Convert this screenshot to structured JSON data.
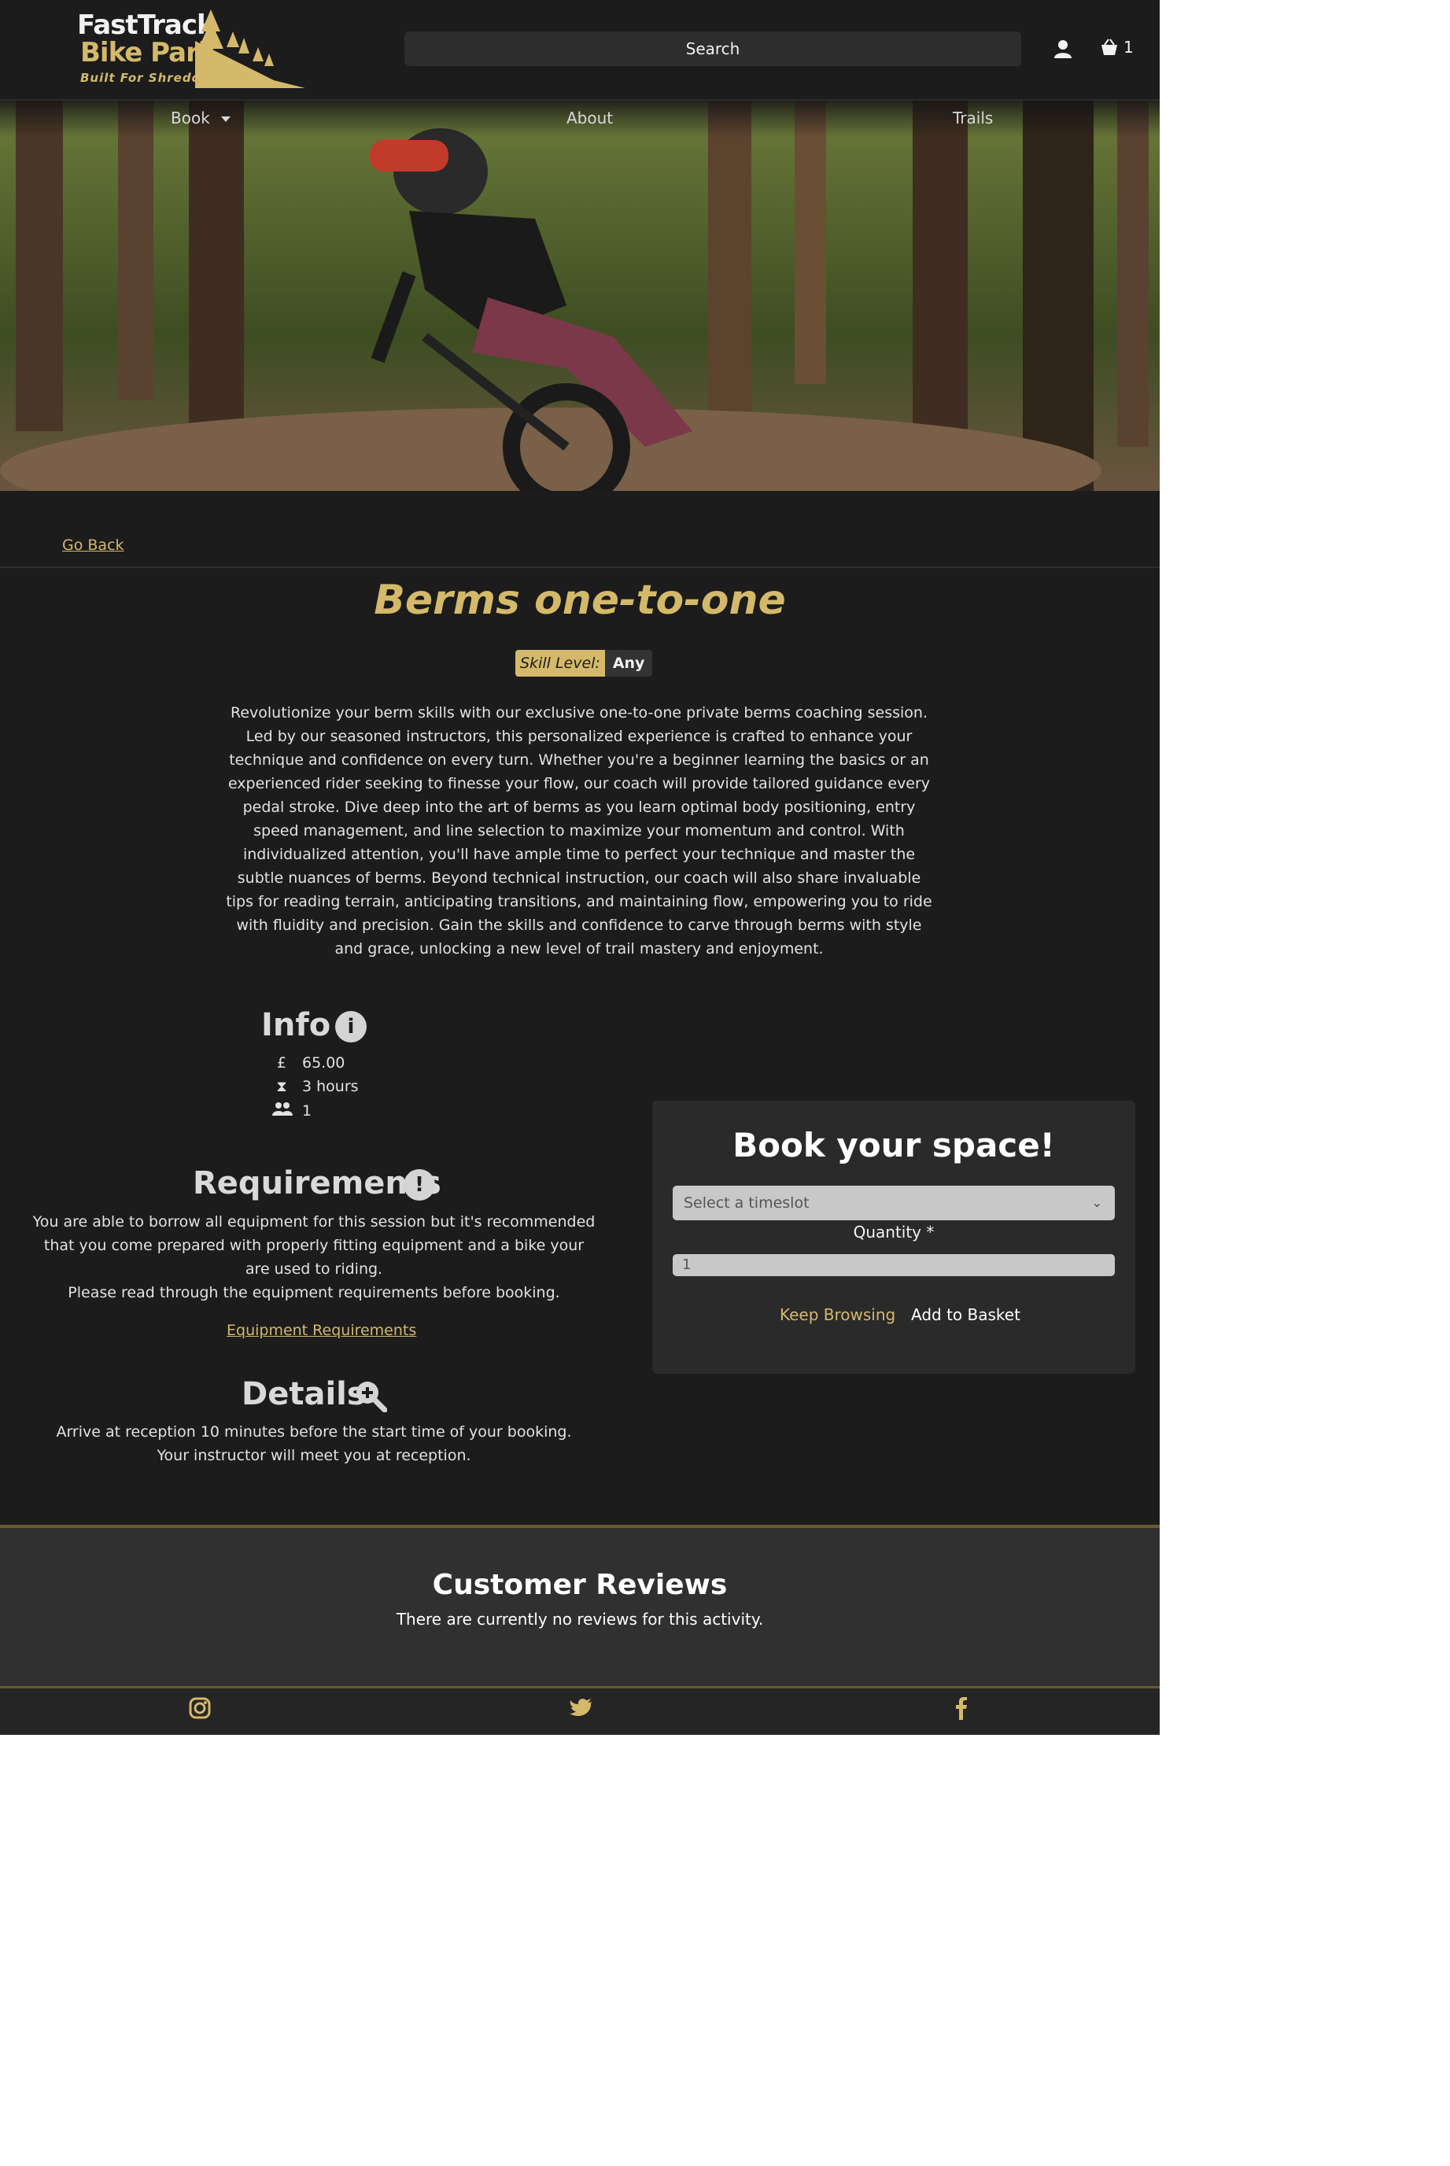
{
  "brand": {
    "line1": "FastTrack",
    "line2": "Bike Park",
    "tagline": "Built For Shredding"
  },
  "header": {
    "search_label": "Search",
    "basket_count": "1"
  },
  "nav": {
    "items": [
      {
        "label": "Book"
      },
      {
        "label": "About"
      },
      {
        "label": "Trails"
      }
    ]
  },
  "page": {
    "back_label": "Go Back",
    "title": "Berms one-to-one",
    "skill_key": "Skill Level:",
    "skill_value": "Any",
    "description": "Revolutionize your berm skills with our exclusive one-to-one private berms coaching session. Led by our seasoned instructors, this personalized experience is crafted to enhance your technique and confidence on every turn. Whether you're a beginner learning the basics or an experienced rider seeking to finesse your flow, our coach will provide tailored guidance every pedal stroke. Dive deep into the art of berms as you learn optimal body positioning, entry speed management, and line selection to maximize your momentum and control. With individualized attention, you'll have ample time to perfect your technique and master the subtle nuances of berms. Beyond technical instruction, our coach will also share invaluable tips for reading terrain, anticipating transitions, and maintaining flow, empowering you to ride with fluidity and precision. Gain the skills and confidence to carve through berms with style and grace, unlocking a new level of trail mastery and enjoyment."
  },
  "info": {
    "heading": "Info",
    "price": "65.00",
    "duration": "3 hours",
    "capacity": "1"
  },
  "requirements": {
    "heading": "Requirements",
    "text1": "You are able to borrow all equipment for this session but it's recommended that you come prepared with properly fitting equipment and a bike your are used to riding.",
    "text2": "Please read through the equipment requirements before booking.",
    "link": "Equipment Requirements"
  },
  "details": {
    "heading": "Details",
    "text": "Arrive at reception 10 minutes before the start time of your booking. Your instructor will meet you at reception."
  },
  "booking": {
    "title": "Book your space!",
    "timeslot_placeholder": "Select a timeslot",
    "quantity_label": "Quantity *",
    "quantity_value": "1",
    "keep_browsing": "Keep Browsing",
    "add_to_basket": "Add to Basket"
  },
  "reviews": {
    "heading": "Customer Reviews",
    "empty_text": "There are currently no reviews for this activity."
  },
  "footer": {
    "icons": [
      "instagram-icon",
      "twitter-icon",
      "facebook-icon"
    ]
  },
  "colors": {
    "accent": "#d4b96a",
    "background": "#1c1c1d",
    "card": "#2a2a2b"
  }
}
